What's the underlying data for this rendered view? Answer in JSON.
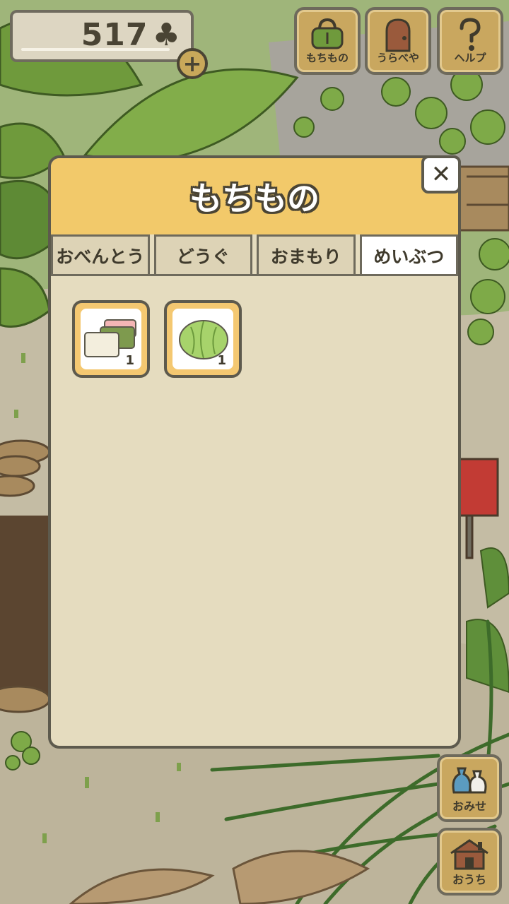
{
  "hud": {
    "clover_count": "517",
    "clover_symbol": "♣",
    "add_symbol": "+"
  },
  "top_buttons": [
    {
      "label": "もちもの",
      "icon": "bag-icon"
    },
    {
      "label": "うらべや",
      "icon": "door-icon"
    },
    {
      "label": "ヘルプ",
      "icon": "question-icon"
    }
  ],
  "dialog": {
    "title": "もちもの",
    "close_symbol": "✕",
    "tabs": [
      "おべんとう",
      "どうぐ",
      "おまもり",
      "めいぶつ"
    ],
    "active_tab": "めいぶつ",
    "items": [
      {
        "icon": "mochi-icon",
        "quantity": "1"
      },
      {
        "icon": "cabbage-icon",
        "quantity": "1"
      }
    ]
  },
  "side_buttons": [
    {
      "label": "おみせ",
      "icon": "shop-bags-icon"
    },
    {
      "label": "おうち",
      "icon": "house-icon"
    }
  ],
  "colors": {
    "dialog_header": "#f2c96a",
    "dialog_body": "#e5dcbf",
    "button_wood": "#c9a75f",
    "outline": "#5d5a4d"
  }
}
